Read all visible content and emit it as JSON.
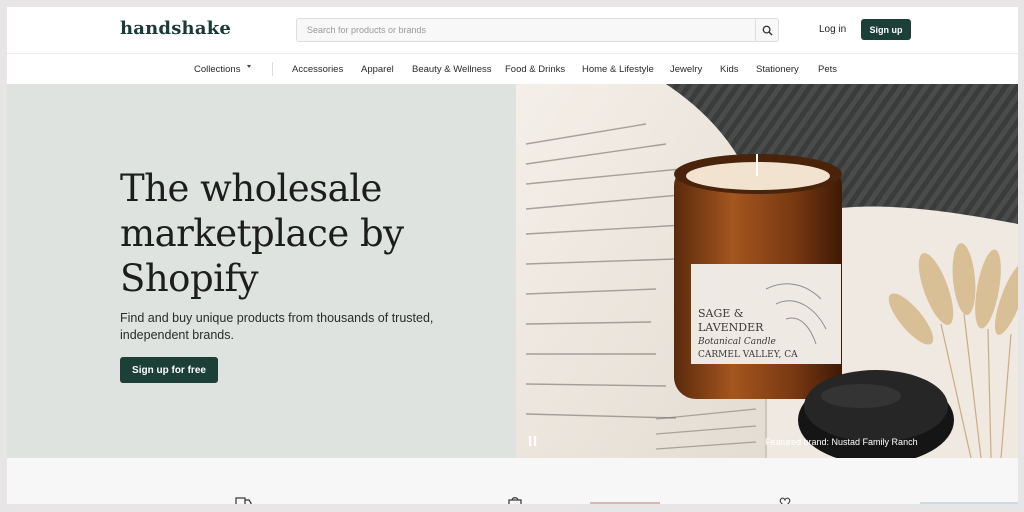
{
  "header": {
    "logo": "handshake",
    "search_placeholder": "Search for products or brands",
    "login_label": "Log in",
    "signup_label": "Sign up"
  },
  "nav": {
    "items": [
      "Collections",
      "Accessories",
      "Apparel",
      "Beauty & Wellness",
      "Food & Drinks",
      "Home & Lifestyle",
      "Jewelry",
      "Kids",
      "Stationery",
      "Pets"
    ]
  },
  "hero": {
    "title": "The wholesale marketplace by Shopify",
    "subtitle": "Find and buy unique products from thousands of trusted, independent brands.",
    "cta_label": "Sign up for free",
    "featured_caption": "Featured brand: Nustad Family Ranch"
  },
  "product": {
    "label_line1": "SAGE &",
    "label_line2": "LAVENDER",
    "label_line3": "Botanical Candle",
    "label_line4": "CARMEL VALLEY, CA"
  },
  "colors": {
    "brand_dark_green": "#1c3f38",
    "hero_bg": "#dee3e0"
  },
  "icons": [
    "search-icon",
    "chevron-down-icon",
    "pause-icon",
    "truck-icon",
    "bag-icon",
    "heart-icon"
  ]
}
